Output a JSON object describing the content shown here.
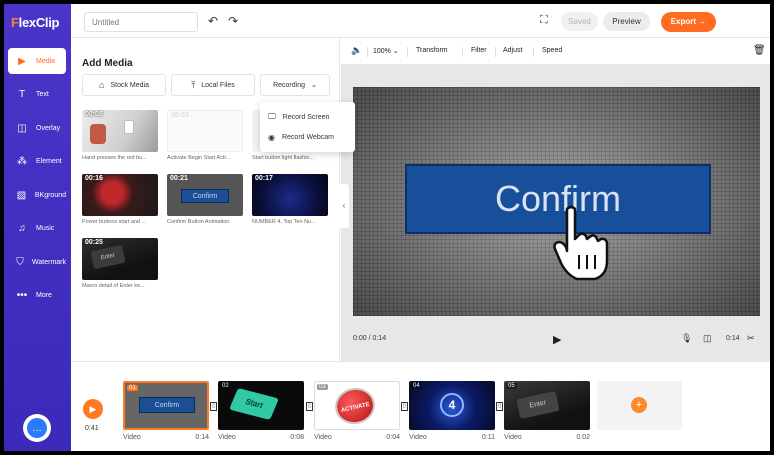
{
  "app": {
    "logo_prefix": "F",
    "logo_rest": "lexClip"
  },
  "sidebar": {
    "items": [
      {
        "label": "Media",
        "icon": "media-icon"
      },
      {
        "label": "Text",
        "icon": "text-icon"
      },
      {
        "label": "Overlay",
        "icon": "overlay-icon"
      },
      {
        "label": "Element",
        "icon": "element-icon"
      },
      {
        "label": "BKground",
        "icon": "background-icon"
      },
      {
        "label": "Music",
        "icon": "music-icon"
      },
      {
        "label": "Watermark",
        "icon": "watermark-icon"
      },
      {
        "label": "More",
        "icon": "more-icon"
      }
    ],
    "active": "Media"
  },
  "topbar": {
    "title_placeholder": "Untitled",
    "saved_label": "Saved",
    "preview_label": "Preview",
    "export_label": "Export"
  },
  "panel": {
    "title": "Add Media",
    "stock_label": "Stock Media",
    "local_label": "Local Files",
    "recording_label": "Recording",
    "dropdown": [
      "Record Screen",
      "Record Webcam"
    ],
    "media": [
      {
        "duration": "00:08",
        "label": "Hand presses the red bu..."
      },
      {
        "duration": "00:03",
        "label": "Activate Begin Start Acti..."
      },
      {
        "duration": "",
        "label": "Start button light flashin..."
      },
      {
        "duration": "00:16",
        "label": "Power buttons start and ..."
      },
      {
        "duration": "00:21",
        "label": "Confirm Button Animation"
      },
      {
        "duration": "00:17",
        "label": "NUMBER 4, Top Ten Nu..."
      },
      {
        "duration": "00:25",
        "label": "Macro detail of Enter ke..."
      }
    ]
  },
  "toolbar": {
    "zoom": "100%",
    "transform": "Transform",
    "filter": "Filter",
    "adjust": "Adjust",
    "speed": "Speed"
  },
  "stage": {
    "canvas_text": "Confirm",
    "time": "0:00 / 0:14",
    "duration": "0:14"
  },
  "timeline": {
    "time": "0:41",
    "clips": [
      {
        "num": "01",
        "type": "Video",
        "duration": "0:14"
      },
      {
        "num": "02",
        "type": "Video",
        "duration": "0:08"
      },
      {
        "num": "03",
        "type": "Video",
        "duration": "0:04"
      },
      {
        "num": "04",
        "type": "Video",
        "duration": "0:11"
      },
      {
        "num": "05",
        "type": "Video",
        "duration": "0:02"
      }
    ],
    "clip_text": {
      "c1": "Confirm",
      "c2": "Start",
      "c3": "ACTIVATE",
      "c4": "4",
      "c5": "Enter"
    }
  },
  "colors": {
    "accent": "#ff6b20",
    "sidebar": "#4330c2",
    "confirm_blue": "#174f9a"
  }
}
